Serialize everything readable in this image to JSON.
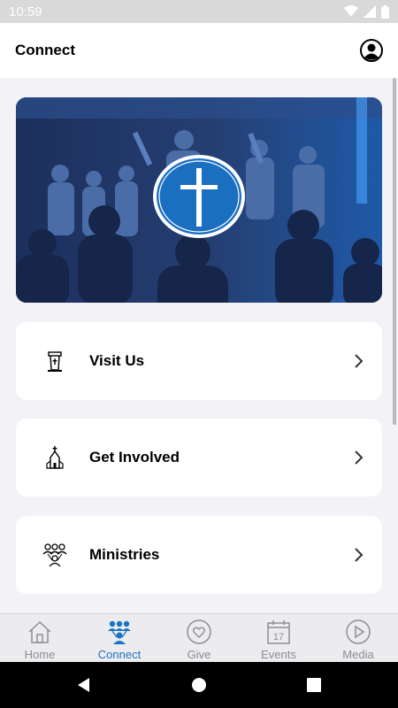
{
  "status_bar": {
    "time": "10:59"
  },
  "header": {
    "title": "Connect"
  },
  "menu": [
    {
      "label": "Visit Us",
      "icon": "pulpit-icon"
    },
    {
      "label": "Get Involved",
      "icon": "church-icon"
    },
    {
      "label": "Ministries",
      "icon": "people-group-icon"
    }
  ],
  "tabs": [
    {
      "label": "Home",
      "icon": "home-icon",
      "active": false
    },
    {
      "label": "Connect",
      "icon": "people-icon",
      "active": true
    },
    {
      "label": "Give",
      "icon": "heart-icon",
      "active": false
    },
    {
      "label": "Events",
      "icon": "calendar-icon",
      "active": false,
      "calendar_day": "17"
    },
    {
      "label": "Media",
      "icon": "play-icon",
      "active": false
    }
  ],
  "colors": {
    "accent": "#1a73c4",
    "hero_overlay": "#1e4a8a",
    "tab_inactive": "#8e8e93"
  }
}
